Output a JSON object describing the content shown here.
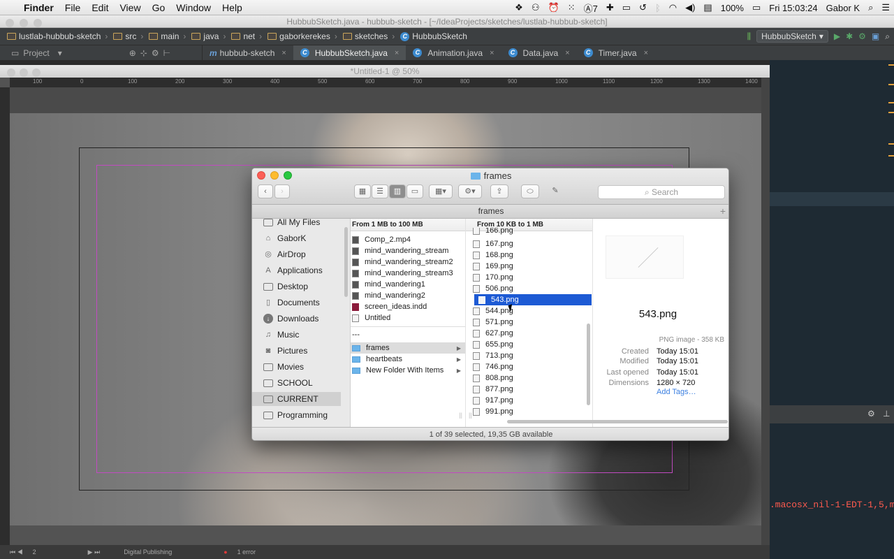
{
  "menubar": {
    "app": "Finder",
    "items": [
      "File",
      "Edit",
      "View",
      "Go",
      "Window",
      "Help"
    ],
    "status": {
      "ai_badge": "7",
      "battery": "100%",
      "clock": "Fri 15:03:24",
      "user": "Gabor K"
    }
  },
  "ide": {
    "title": "HubbubSketch.java - hubbub-sketch - [~/IdeaProjects/sketches/lustlab-hubbub-sketch]",
    "breadcrumbs": [
      "lustlab-hubbub-sketch",
      "src",
      "main",
      "java",
      "net",
      "gaborkerekes",
      "sketches",
      "HubbubSketch"
    ],
    "run_config": "HubbubSketch",
    "project_label": "Project",
    "tabs": [
      "hubbub-sketch",
      "HubbubSketch.java",
      "Animation.java",
      "Data.java",
      "Timer.java"
    ],
    "error_snippet": ".macosx_nil-1-EDT-1,5,ma"
  },
  "indesign": {
    "title": "*Untitled-1 @ 50%",
    "ruler_ticks": [
      "100",
      "0",
      "100",
      "200",
      "300",
      "400",
      "500",
      "600",
      "700",
      "800",
      "900",
      "1000",
      "1100",
      "1200",
      "1300",
      "1400"
    ],
    "status": {
      "page": "2",
      "workspace": "Digital Publishing",
      "errors": "1 error"
    }
  },
  "finder": {
    "title": "frames",
    "search_placeholder": "Search",
    "path": "frames",
    "sidebar": [
      "All My Files",
      "GaborK",
      "AirDrop",
      "Applications",
      "Desktop",
      "Documents",
      "Downloads",
      "Music",
      "Pictures",
      "Movies",
      "SCHOOL",
      "CURRENT",
      "Programming"
    ],
    "col1": {
      "header": "From 1 MB to 100 MB",
      "files": [
        "Comp_2.mp4",
        "mind_wandering_stream",
        "mind_wandering_stream2",
        "mind_wandering_stream3",
        "mind_wandering1",
        "mind_wandering2",
        "screen_ideas.indd",
        "Untitled"
      ],
      "separator": "---",
      "folders": [
        "frames",
        "heartbeats",
        "New Folder With Items"
      ]
    },
    "col2": {
      "header": "From 10 KB to 1 MB",
      "files": [
        "166.png",
        "167.png",
        "168.png",
        "169.png",
        "170.png",
        "506.png",
        "543.png",
        "544.png",
        "571.png",
        "627.png",
        "655.png",
        "713.png",
        "746.png",
        "808.png",
        "877.png",
        "917.png",
        "991.png"
      ]
    },
    "preview": {
      "name": "543.png",
      "type": "PNG image - 358 KB",
      "created_label": "Created",
      "created": "Today 15:01",
      "modified_label": "Modified",
      "modified": "Today 15:01",
      "opened_label": "Last opened",
      "opened": "Today 15:01",
      "dims_label": "Dimensions",
      "dims": "1280 × 720",
      "add_tags": "Add Tags…"
    },
    "status": "1 of 39 selected, 19,35 GB available"
  }
}
